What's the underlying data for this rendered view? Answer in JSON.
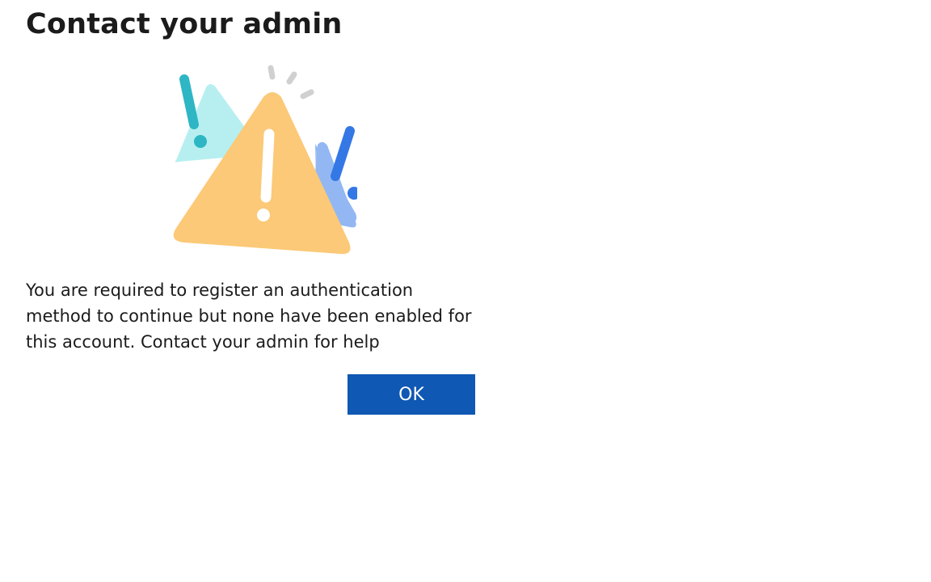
{
  "dialog": {
    "title": "Contact your admin",
    "illustration": "warning-triangles-illustration",
    "message": "You are required to register an authentication method to continue but none have been enabled for this account. Contact your admin for help",
    "ok_label": "OK"
  },
  "colors": {
    "background": "#ffffff",
    "text": "#1b1b1b",
    "button": "#0f58b3",
    "button_text": "#ffffff",
    "warning_main": "#fbc977",
    "warning_teal": "#b7eff0",
    "warning_teal_mark": "#2eb6c4",
    "warning_blue": "#92b7f3",
    "warning_blue_mark": "#3478e5"
  }
}
